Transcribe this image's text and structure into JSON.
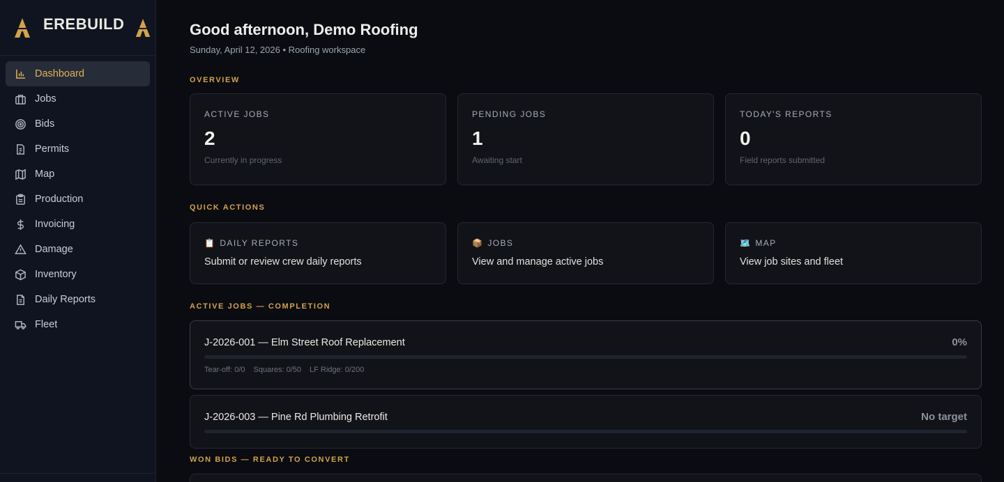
{
  "brand": {
    "name": "EREBUILD",
    "logo_icon": "hazard-a-icon",
    "accent": "#d4a24a"
  },
  "sidebar": {
    "items": [
      {
        "label": "Dashboard",
        "icon": "bar-chart-icon",
        "active": true
      },
      {
        "label": "Jobs",
        "icon": "briefcase-icon"
      },
      {
        "label": "Bids",
        "icon": "target-icon"
      },
      {
        "label": "Permits",
        "icon": "document-icon"
      },
      {
        "label": "Map",
        "icon": "map-icon"
      },
      {
        "label": "Production",
        "icon": "clipboard-icon"
      },
      {
        "label": "Invoicing",
        "icon": "dollar-icon"
      },
      {
        "label": "Damage",
        "icon": "warning-icon"
      },
      {
        "label": "Inventory",
        "icon": "box-icon"
      },
      {
        "label": "Daily Reports",
        "icon": "report-icon"
      },
      {
        "label": "Fleet",
        "icon": "truck-icon"
      }
    ]
  },
  "header": {
    "greeting": "Good afternoon, Demo Roofing",
    "subline": "Sunday, April 12, 2026 • Roofing workspace"
  },
  "overview": {
    "label": "OVERVIEW",
    "stats": [
      {
        "label": "ACTIVE JOBS",
        "value": "2",
        "sub": "Currently in progress"
      },
      {
        "label": "PENDING JOBS",
        "value": "1",
        "sub": "Awaiting start"
      },
      {
        "label": "TODAY'S REPORTS",
        "value": "0",
        "sub": "Field reports submitted"
      }
    ]
  },
  "quick_actions": {
    "label": "QUICK ACTIONS",
    "items": [
      {
        "emoji": "📋",
        "title": "DAILY REPORTS",
        "desc": "Submit or review crew daily reports"
      },
      {
        "emoji": "📦",
        "title": "JOBS",
        "desc": "View and manage active jobs"
      },
      {
        "emoji": "🗺️",
        "title": "MAP",
        "desc": "View job sites and fleet"
      }
    ]
  },
  "active_jobs": {
    "label": "ACTIVE JOBS — COMPLETION",
    "jobs": [
      {
        "title": "J-2026-001 — Elm Street Roof Replacement",
        "pct": "0%",
        "progress": 0,
        "metrics": [
          "Tear-off: 0/0",
          "Squares: 0/50",
          "LF Ridge: 0/200"
        ]
      },
      {
        "title": "J-2026-003 — Pine Rd Plumbing Retrofit",
        "pct": "No target",
        "progress": 0,
        "metrics": []
      }
    ]
  },
  "won_bids": {
    "label": "WON BIDS — READY TO CONVERT"
  }
}
